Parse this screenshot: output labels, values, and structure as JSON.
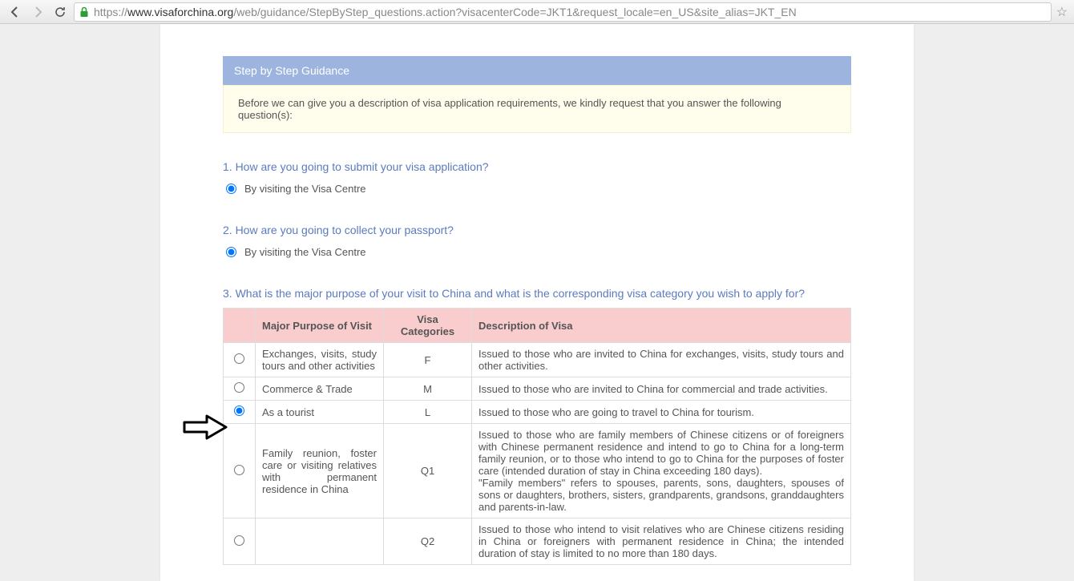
{
  "browser": {
    "url_scheme": "https://",
    "url_host": "www.visaforchina.org",
    "url_path": "/web/guidance/StepByStep_questions.action?visacenterCode=JKT1&request_locale=en_US&site_alias=JKT_EN"
  },
  "banner": "Step by Step Guidance",
  "notice": "Before we can give you a description of visa application requirements, we kindly request that you answer the following question(s):",
  "q1": {
    "title": "1. How are you going to submit your visa application?",
    "option": "By visiting the Visa Centre"
  },
  "q2": {
    "title": "2. How are you going to collect your passport?",
    "option": "By visiting the Visa Centre"
  },
  "q3": {
    "title": "3. What is the major purpose of your visit to China and what is the corresponding visa category you wish to apply for?"
  },
  "table": {
    "headers": {
      "purpose": "Major Purpose of Visit",
      "categories": "Visa Categories",
      "description": "Description of Visa"
    },
    "rows": [
      {
        "purpose": "Exchanges, visits, study tours and other activities",
        "cat": "F",
        "desc": "Issued to those who are invited to China for exchanges, visits, study tours and other activities."
      },
      {
        "purpose": "Commerce & Trade",
        "cat": "M",
        "desc": "Issued to those who are invited to China for commercial and trade activities."
      },
      {
        "purpose": "As a tourist",
        "cat": "L",
        "desc": "Issued to those who are going to travel to China for tourism."
      },
      {
        "purpose": "Family reunion, foster care or visiting relatives with permanent residence in China",
        "cat": "Q1",
        "desc": "Issued to those who are family members of Chinese citizens or of foreigners with Chinese permanent residence and intend to go to China for a long-term family reunion, or to those who intend to go to China for the purposes of foster care (intended duration of stay in China exceeding 180 days).\n\"Family members\" refers to spouses, parents, sons, daughters, spouses of sons or daughters, brothers, sisters, grandparents, grandsons, granddaughters and parents-in-law."
      },
      {
        "purpose": "",
        "cat": "Q2",
        "desc": "Issued to those who intend to visit relatives who are Chinese citizens residing in China or foreigners with permanent residence in China; the intended duration of stay is limited to no more than 180 days."
      }
    ]
  }
}
